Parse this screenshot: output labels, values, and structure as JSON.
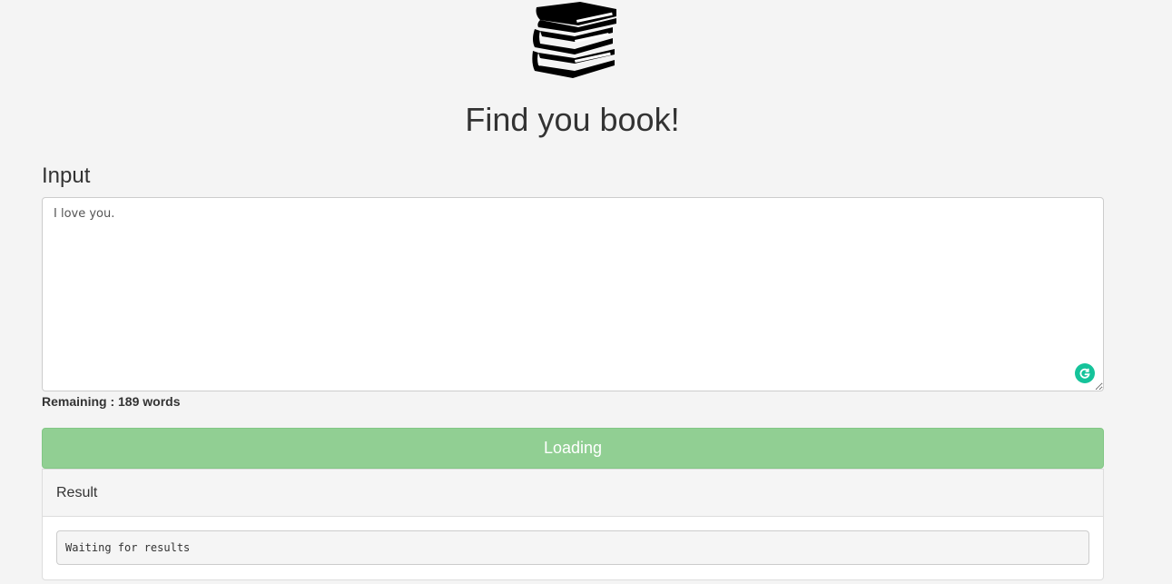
{
  "header": {
    "logo_icon": "books-stack-icon",
    "title": "Find you book!"
  },
  "input": {
    "label": "Input",
    "value": "I love you.",
    "grammarly_icon": "grammarly-icon",
    "grammarly_color": "#15c39a"
  },
  "remaining": {
    "text": "Remaining : 189 words"
  },
  "submit": {
    "label": "Loading",
    "color": "#91cf93"
  },
  "result": {
    "heading": "Result",
    "output": "Waiting for results"
  }
}
